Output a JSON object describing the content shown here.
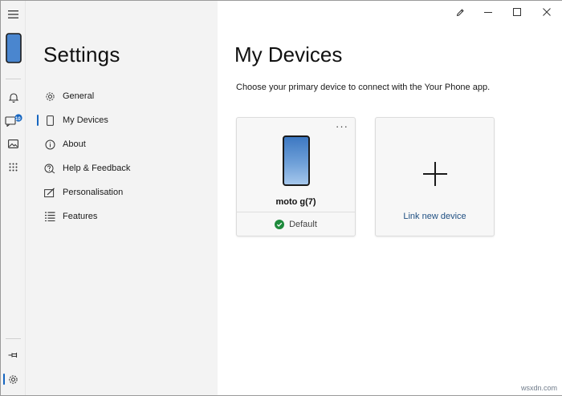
{
  "settings": {
    "title": "Settings",
    "nav_items": [
      {
        "label": "General",
        "icon": "gear-icon",
        "active": false
      },
      {
        "label": "My Devices",
        "icon": "phone-icon",
        "active": true
      },
      {
        "label": "About",
        "icon": "info-icon",
        "active": false
      },
      {
        "label": "Help & Feedback",
        "icon": "help-chat-icon",
        "active": false
      },
      {
        "label": "Personalisation",
        "icon": "personalisation-icon",
        "active": false
      },
      {
        "label": "Features",
        "icon": "features-list-icon",
        "active": false
      }
    ]
  },
  "rail": {
    "items": [
      "hamburger-menu-icon",
      "phone-thumbnail",
      "bell-icon",
      "messages-icon",
      "photos-icon",
      "apps-grid-icon",
      "pin-icon",
      "gear-icon"
    ],
    "messages_badge": "10"
  },
  "titlebar": {
    "buttons": [
      "pen-icon",
      "minimize-icon",
      "maximize-icon",
      "close-icon"
    ]
  },
  "main": {
    "title": "My Devices",
    "subtitle": "Choose your primary device to connect with the Your Phone app.",
    "device_card": {
      "name": "moto g(7)",
      "status": "Default",
      "more_label": "···"
    },
    "link_card": {
      "label": "Link new device"
    }
  },
  "colors": {
    "accent": "#1565c0",
    "link": "#1f4f82",
    "success": "#1e8a3c",
    "pane_bg": "#f3f3f3"
  },
  "watermark": "wsxdn.com"
}
